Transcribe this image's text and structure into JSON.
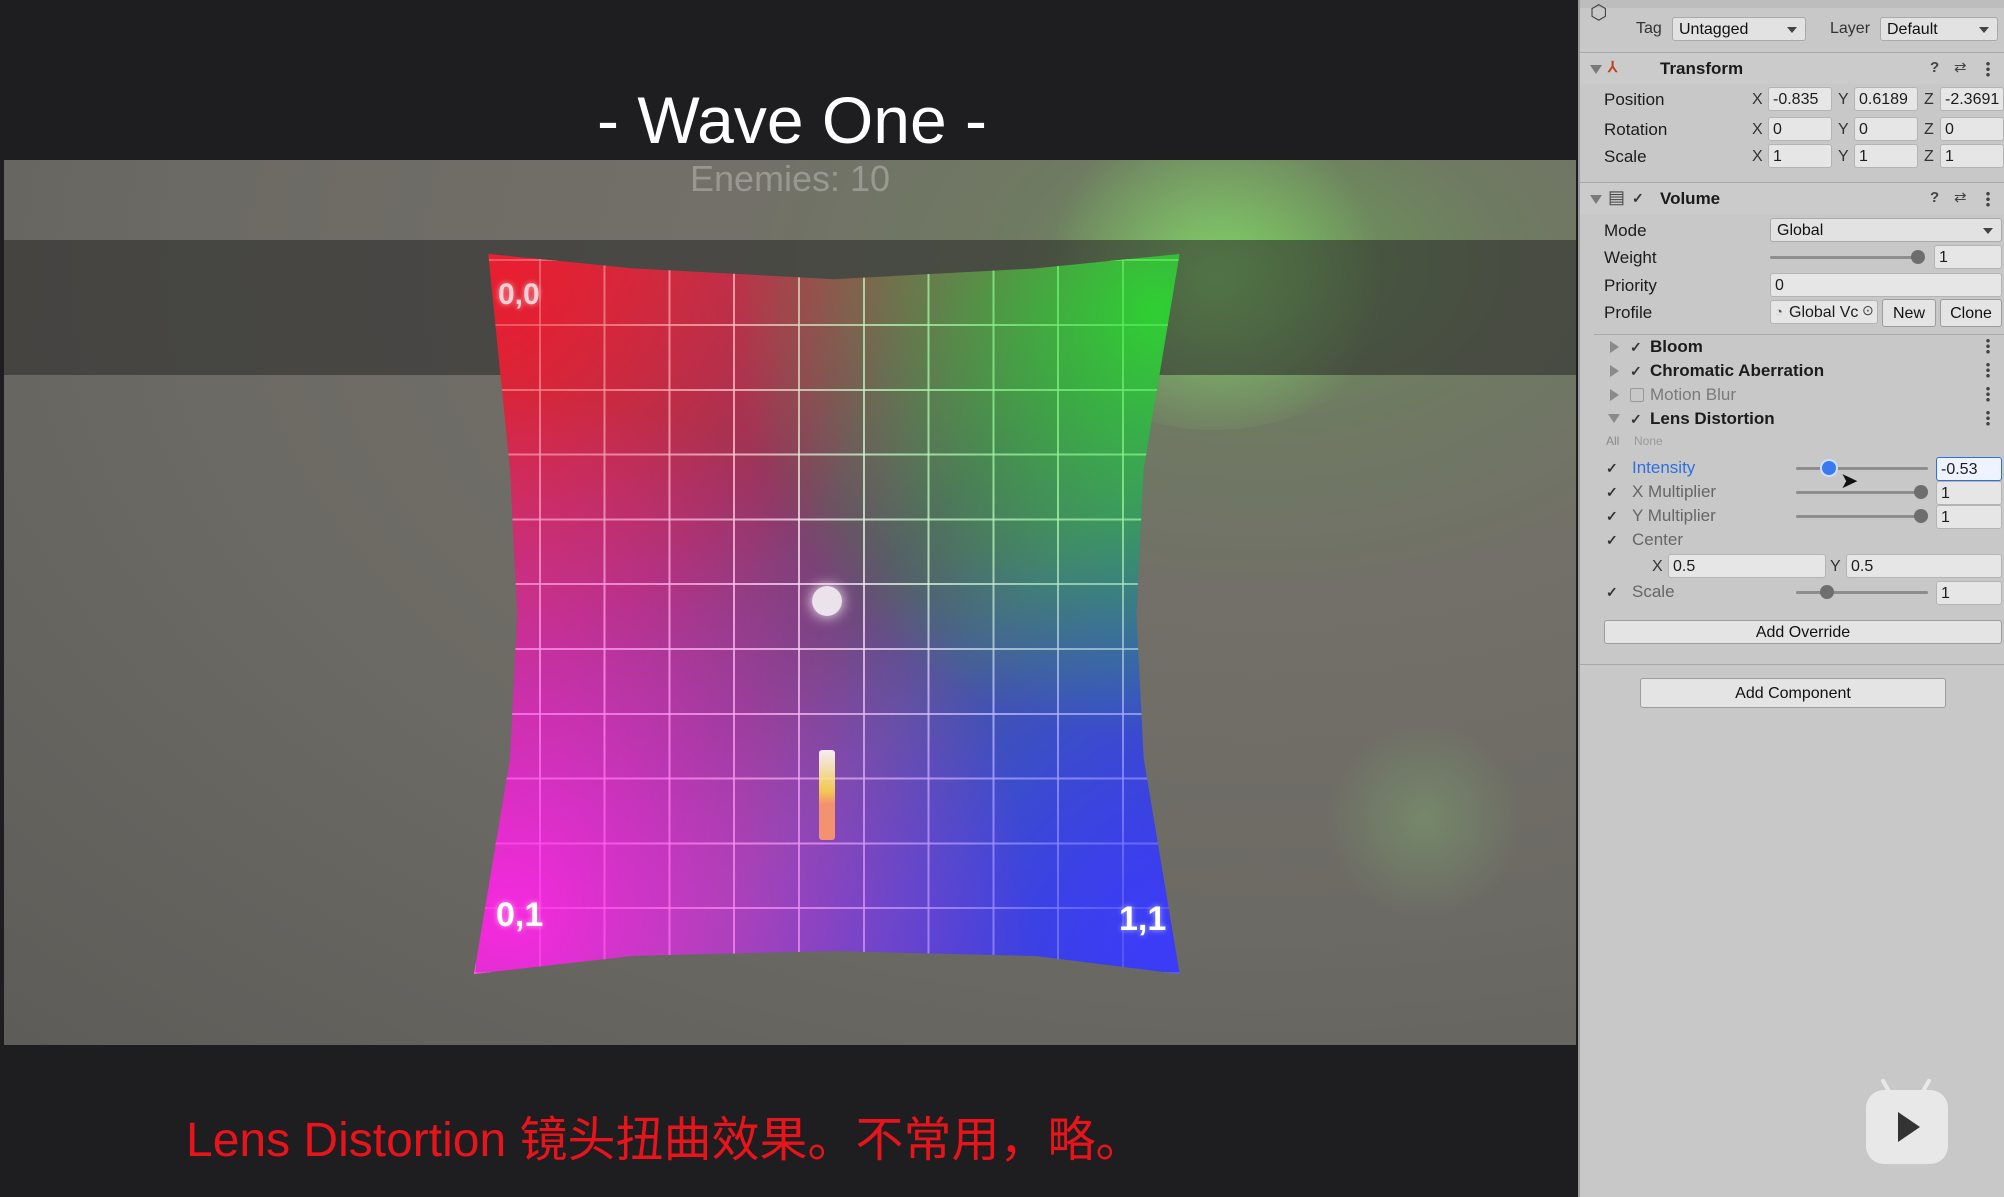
{
  "game": {
    "wave_title": "- Wave One -",
    "enemies_text": "Enemies: 10",
    "corner_labels": {
      "top_left": "0,0",
      "bottom_left": "0,1",
      "bottom_right": "1,1"
    }
  },
  "subtitle": "Lens Distortion 镜头扭曲效果。不常用，略。",
  "inspector": {
    "top": {
      "tag_label": "Tag",
      "tag_value": "Untagged",
      "layer_label": "Layer",
      "layer_value": "Default"
    },
    "transform": {
      "title": "Transform",
      "position": {
        "label": "Position",
        "x": "-0.835",
        "y": "0.6189",
        "z": "-2.3691"
      },
      "rotation": {
        "label": "Rotation",
        "x": "0",
        "y": "0",
        "z": "0"
      },
      "scale": {
        "label": "Scale",
        "x": "1",
        "y": "1",
        "z": "1"
      }
    },
    "volume": {
      "title": "Volume",
      "mode_label": "Mode",
      "mode_value": "Global",
      "weight_label": "Weight",
      "weight_value": "1",
      "weight_fraction": 1.0,
      "priority_label": "Priority",
      "priority_value": "0",
      "profile_label": "Profile",
      "profile_value": "Global Vc",
      "new_button": "New",
      "clone_button": "Clone"
    },
    "overrides": [
      {
        "label": "Bloom",
        "enabled": true
      },
      {
        "label": "Chromatic Aberration",
        "enabled": true
      },
      {
        "label": "Motion Blur",
        "enabled": false
      },
      {
        "label": "Lens Distortion",
        "enabled": true,
        "expanded": true
      }
    ],
    "all_label": "All",
    "none_label": "None",
    "lens": {
      "intensity": {
        "label": "Intensity",
        "value": "-0.53"
      },
      "x_multiplier": {
        "label": "X Multiplier",
        "value": "1"
      },
      "y_multiplier": {
        "label": "Y Multiplier",
        "value": "1"
      },
      "center": {
        "label": "Center",
        "x_axis": "X",
        "x": "0.5",
        "y_axis": "Y",
        "y": "0.5"
      },
      "scale": {
        "label": "Scale",
        "value": "1"
      }
    },
    "add_override_button": "Add Override",
    "add_component_button": "Add Component"
  },
  "colors": {
    "subtitle": "#e8141c",
    "inspector_bg": "#c8c8c8",
    "accent_blue": "#2f6fe0"
  }
}
